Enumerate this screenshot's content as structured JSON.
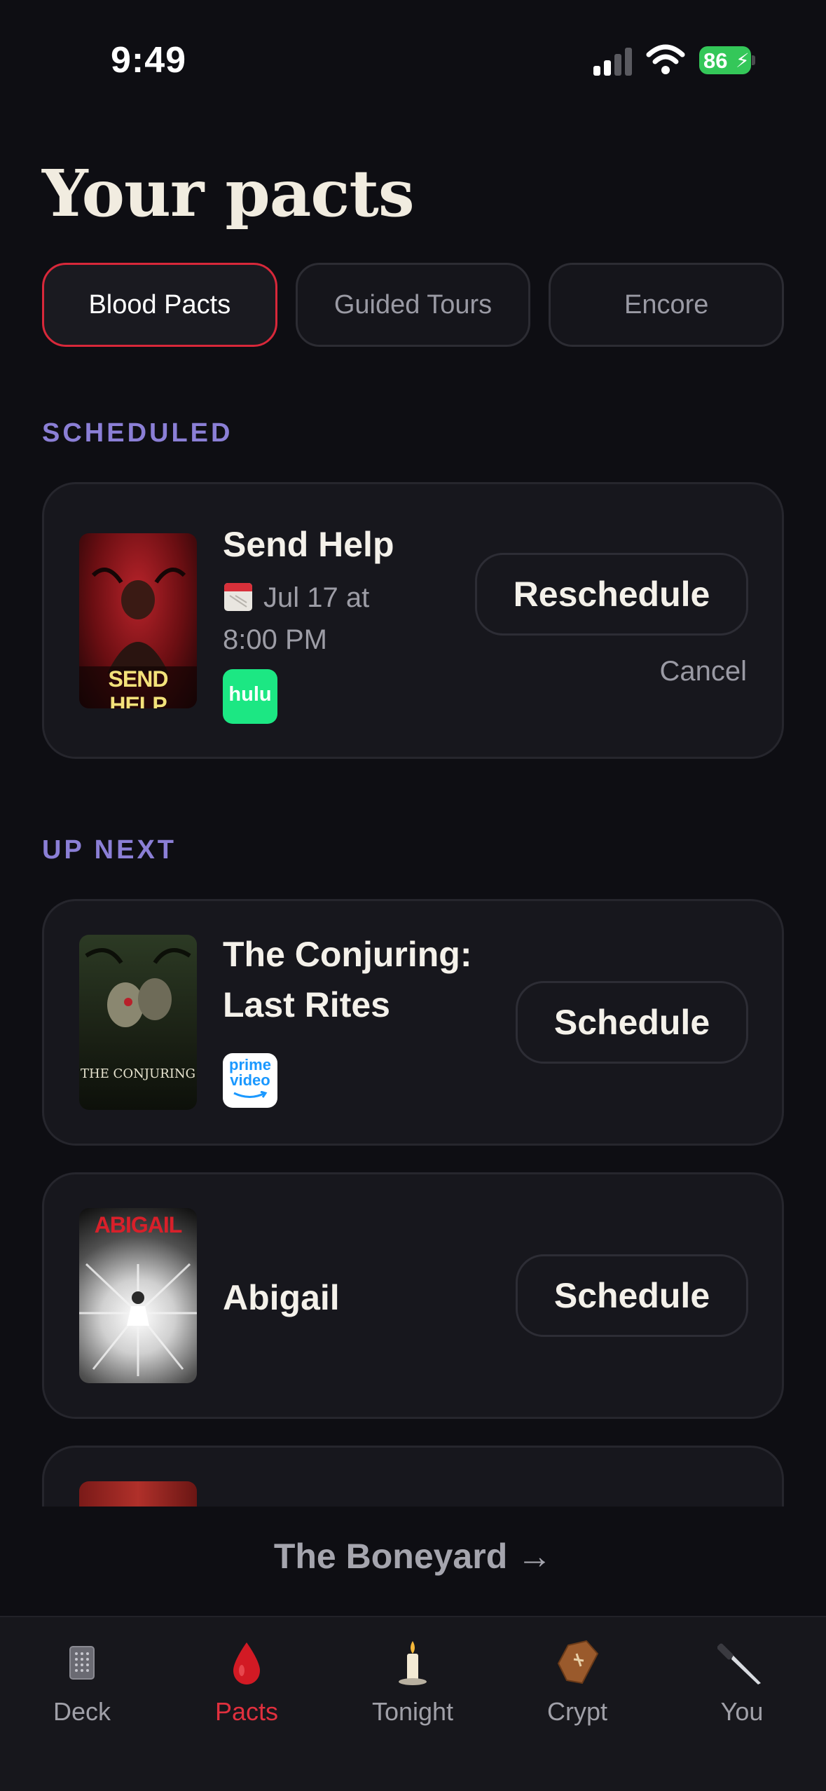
{
  "status_bar": {
    "time": "9:49",
    "battery": "86"
  },
  "header": {
    "title": "Your pacts"
  },
  "tabs": [
    {
      "label": "Blood Pacts",
      "active": true
    },
    {
      "label": "Guided Tours",
      "active": false
    },
    {
      "label": "Encore",
      "active": false
    }
  ],
  "scheduled": {
    "label": "SCHEDULED",
    "items": [
      {
        "title": "Send Help",
        "date_line1": "Jul 17 at",
        "date_line2": "8:00 PM",
        "poster_text": "SEND HELP",
        "provider": "hulu",
        "action": "Reschedule",
        "secondary_action": "Cancel"
      }
    ]
  },
  "up_next": {
    "label": "UP NEXT",
    "items": [
      {
        "title_line1": "The Conjuring:",
        "title_line2": "Last Rites",
        "poster_text": "THE CONJURING",
        "provider_line1": "prime",
        "provider_line2": "video",
        "action": "Schedule"
      },
      {
        "title": "Abigail",
        "poster_text": "ABIGAIL",
        "action": "Schedule"
      }
    ]
  },
  "footer_link": "The Boneyard →",
  "tabbar": [
    {
      "label": "Deck",
      "icon": "deck-icon",
      "active": false
    },
    {
      "label": "Pacts",
      "icon": "blood-drop-icon",
      "active": true
    },
    {
      "label": "Tonight",
      "icon": "candle-icon",
      "active": false
    },
    {
      "label": "Crypt",
      "icon": "coffin-icon",
      "active": false
    },
    {
      "label": "You",
      "icon": "knife-icon",
      "active": false
    }
  ],
  "colors": {
    "accent": "#d8283a",
    "section": "#8b7fd6",
    "background": "#0e0e13",
    "card": "#17171d"
  }
}
